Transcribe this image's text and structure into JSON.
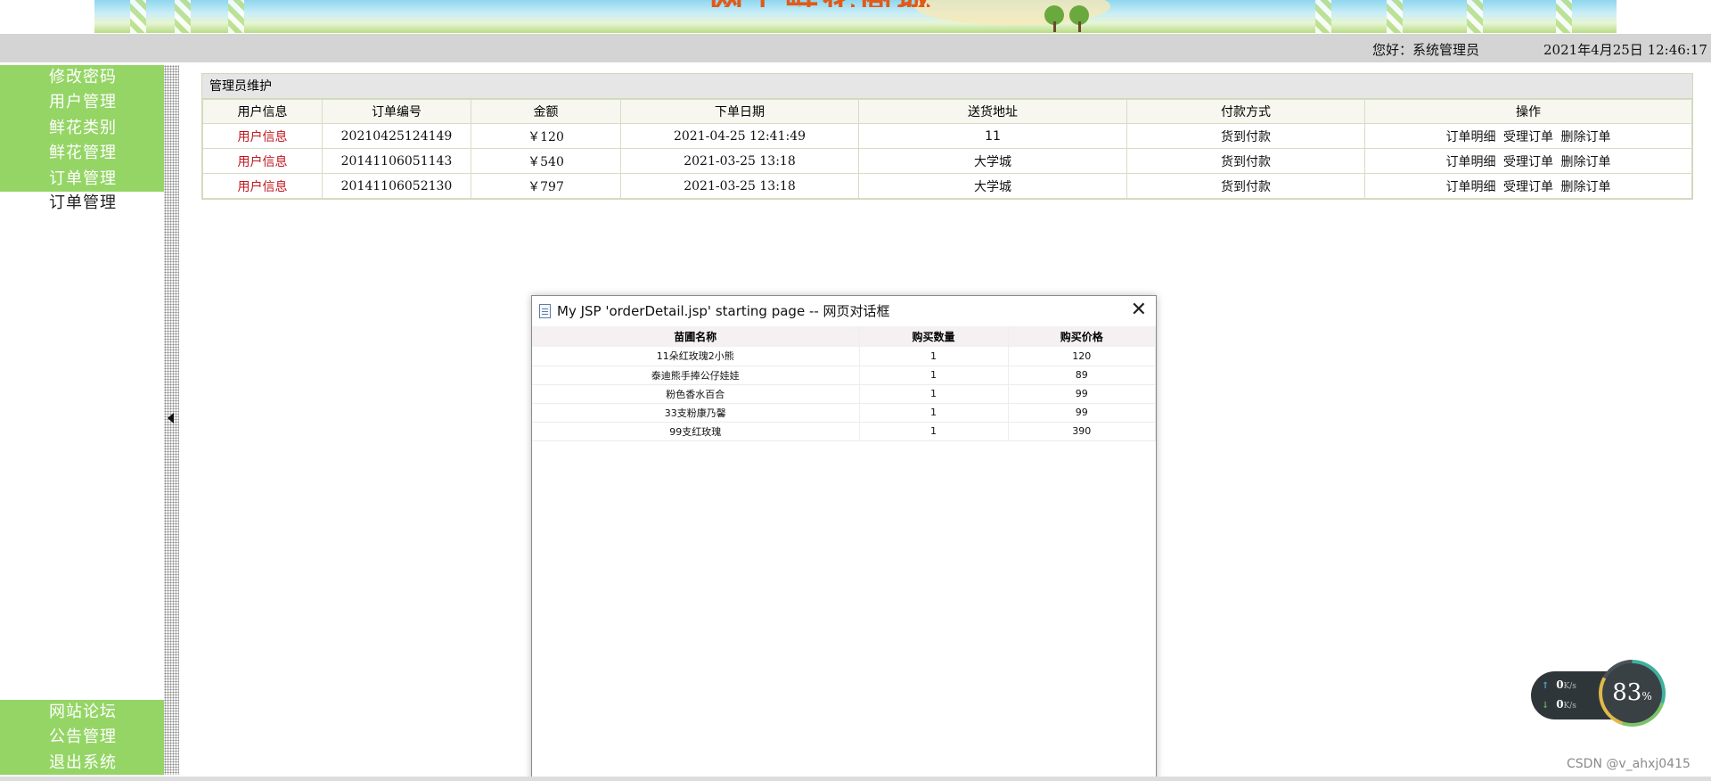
{
  "banner": {
    "title_fragment": "网上鲜花商城"
  },
  "topbar": {
    "greeting": "您好：系统管理员",
    "datetime": "2021年4月25日 12:46:17"
  },
  "sidebar": {
    "items": [
      {
        "label": "修改密码"
      },
      {
        "label": "用户管理"
      },
      {
        "label": "鲜花类别"
      },
      {
        "label": "鲜花管理"
      },
      {
        "label": "订单管理"
      }
    ],
    "sub_item": "订单管理",
    "bottom_items": [
      {
        "label": "网站论坛"
      },
      {
        "label": "公告管理"
      },
      {
        "label": "退出系统"
      }
    ]
  },
  "panel": {
    "title": "管理员维护",
    "headers": [
      "用户信息",
      "订单编号",
      "金额",
      "下单日期",
      "送货地址",
      "付款方式",
      "操作"
    ],
    "rows": [
      {
        "user": "用户信息",
        "order_no": "20210425124149",
        "amount": "￥120",
        "date": "2021-04-25 12:41:49",
        "address": "11",
        "payment": "货到付款"
      },
      {
        "user": "用户信息",
        "order_no": "20141106051143",
        "amount": "￥540",
        "date": "2021-03-25 13:18",
        "address": "大学城",
        "payment": "货到付款"
      },
      {
        "user": "用户信息",
        "order_no": "20141106052130",
        "amount": "￥797",
        "date": "2021-03-25 13:18",
        "address": "大学城",
        "payment": "货到付款"
      }
    ],
    "ops": [
      "订单明细",
      "受理订单",
      "删除订单"
    ]
  },
  "dialog": {
    "title": "My JSP 'orderDetail.jsp' starting page -- 网页对话框",
    "close": "✕",
    "headers": [
      "苗圃名称",
      "购买数量",
      "购买价格"
    ],
    "rows": [
      {
        "name": "11朵红玫瑰2小熊",
        "qty": "1",
        "price": "120"
      },
      {
        "name": "泰迪熊手捧公仔娃娃",
        "qty": "1",
        "price": "89"
      },
      {
        "name": "粉色香水百合",
        "qty": "1",
        "price": "99"
      },
      {
        "name": "33支粉康乃馨",
        "qty": "1",
        "price": "99"
      },
      {
        "name": "99支红玫瑰",
        "qty": "1",
        "price": "390"
      }
    ]
  },
  "speed_widget": {
    "up_value": "0",
    "up_unit": "K/s",
    "down_value": "0",
    "down_unit": "K/s",
    "percent": "83",
    "percent_sign": "%"
  },
  "watermark": "CSDN @v_ahxj0415"
}
